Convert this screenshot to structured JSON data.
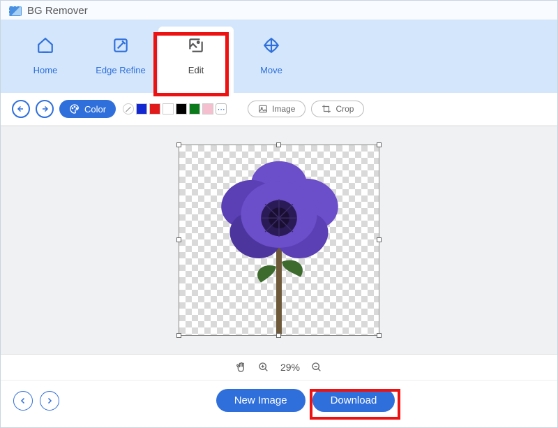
{
  "title": "BG Remover",
  "nav": {
    "home": "Home",
    "edge_refine": "Edge Refine",
    "edit": "Edit",
    "move": "Move"
  },
  "subbar": {
    "color_label": "Color",
    "swatches": [
      "#1428d2",
      "#e11b1b",
      "#ffffff",
      "#000000",
      "#0a7a1a",
      "#f5bfcf"
    ],
    "image_label": "Image",
    "crop_label": "Crop"
  },
  "zoom": {
    "value": "29%"
  },
  "footer": {
    "new_image": "New Image",
    "download": "Download"
  }
}
